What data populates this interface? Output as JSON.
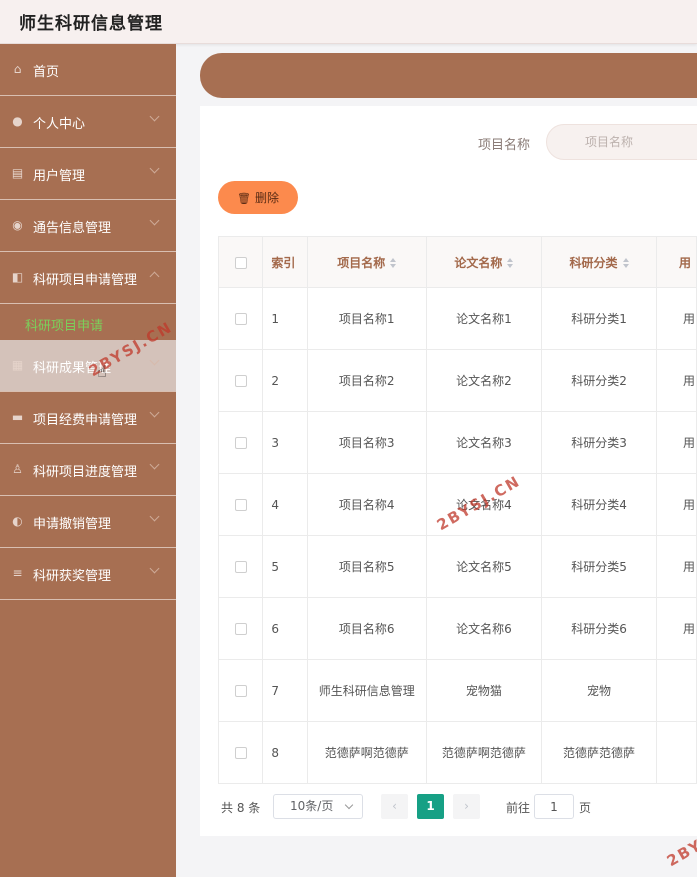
{
  "app": {
    "title": "师生科研信息管理"
  },
  "sidebar": {
    "items": [
      {
        "label": "首页",
        "icon": "home-icon",
        "glyph": "⌂"
      },
      {
        "label": "个人中心",
        "icon": "user-icon",
        "glyph": "●"
      },
      {
        "label": "用户管理",
        "icon": "clipboard-icon",
        "glyph": "▤"
      },
      {
        "label": "通告信息管理",
        "icon": "microphone-icon",
        "glyph": "◉"
      },
      {
        "label": "科研项目申请管理",
        "icon": "folder-icon",
        "glyph": "◧"
      },
      {
        "label": "科研成果管理",
        "icon": "grid-icon",
        "glyph": "▦"
      },
      {
        "label": "项目经费申请管理",
        "icon": "chat-icon",
        "glyph": "▬"
      },
      {
        "label": "科研项目进度管理",
        "icon": "person-icon",
        "glyph": "♙"
      },
      {
        "label": "申请撤销管理",
        "icon": "bulb-icon",
        "glyph": "◐"
      },
      {
        "label": "科研获奖管理",
        "icon": "list-icon",
        "glyph": "≡"
      }
    ],
    "submenu": {
      "label": "科研项目申请"
    }
  },
  "search": {
    "label": "项目名称",
    "placeholder": "项目名称"
  },
  "toolbar": {
    "delete_label": "删除",
    "delete_icon": "trash-icon"
  },
  "table": {
    "headers": {
      "index": "索引",
      "project": "项目名称",
      "paper": "论文名称",
      "category": "科研分类",
      "user": "用"
    },
    "rows": [
      {
        "index": "1",
        "project": "项目名称1",
        "paper": "论文名称1",
        "category": "科研分类1",
        "user": "用"
      },
      {
        "index": "2",
        "project": "项目名称2",
        "paper": "论文名称2",
        "category": "科研分类2",
        "user": "用"
      },
      {
        "index": "3",
        "project": "项目名称3",
        "paper": "论文名称3",
        "category": "科研分类3",
        "user": "用"
      },
      {
        "index": "4",
        "project": "项目名称4",
        "paper": "论文名称4",
        "category": "科研分类4",
        "user": "用"
      },
      {
        "index": "5",
        "project": "项目名称5",
        "paper": "论文名称5",
        "category": "科研分类5",
        "user": "用"
      },
      {
        "index": "6",
        "project": "项目名称6",
        "paper": "论文名称6",
        "category": "科研分类6",
        "user": "用"
      },
      {
        "index": "7",
        "project": "师生科研信息管理",
        "paper": "宠物猫",
        "category": "宠物",
        "user": ""
      },
      {
        "index": "8",
        "project": "范德萨啊范德萨",
        "paper": "范德萨啊范德萨",
        "category": "范德萨范德萨",
        "user": ""
      }
    ]
  },
  "pagination": {
    "total": "共 8 条",
    "page_size": "10条/页",
    "prev": "‹",
    "current": "1",
    "next": "›",
    "goto_label": "前往",
    "goto_value": "1",
    "page_suffix": "页"
  },
  "watermark": {
    "text": "2BYSJ.CN"
  },
  "colors": {
    "sidebar": "#a76f52",
    "accent": "#fc8a4d",
    "active_page": "#16a085",
    "submenu_active": "#7bd05b"
  }
}
